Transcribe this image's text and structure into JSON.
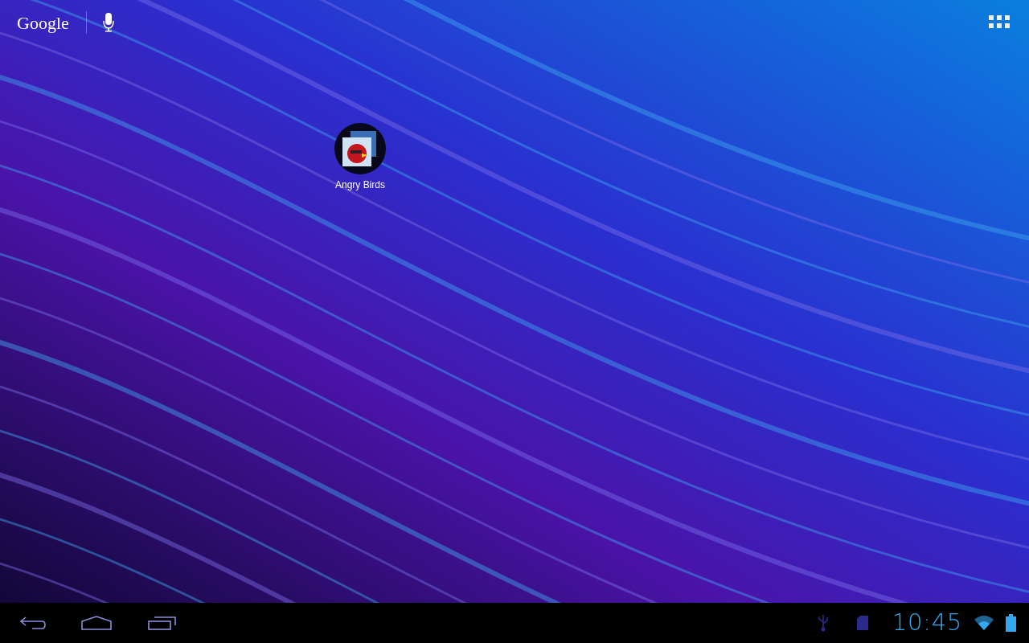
{
  "search_bar": {
    "logo": "Google"
  },
  "home_apps": [
    {
      "label": "Angry Birds"
    }
  ],
  "status_bar": {
    "clock": "10:45"
  }
}
